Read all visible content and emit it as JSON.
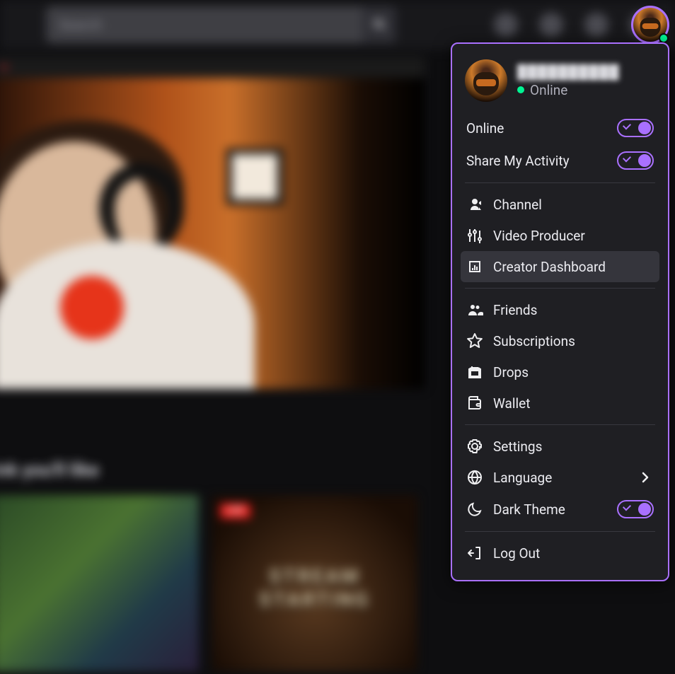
{
  "nav": {
    "search_placeholder": "Search"
  },
  "menu": {
    "username": "██████████",
    "status_text": "Online",
    "toggles": {
      "online": {
        "label": "Online",
        "on": true
      },
      "share_activity": {
        "label": "Share My Activity",
        "on": true
      },
      "dark_theme": {
        "label": "Dark Theme",
        "on": true
      }
    },
    "items": {
      "channel": "Channel",
      "video_producer": "Video Producer",
      "creator_dashboard": "Creator Dashboard",
      "friends": "Friends",
      "subscriptions": "Subscriptions",
      "drops": "Drops",
      "wallet": "Wallet",
      "settings": "Settings",
      "language": "Language",
      "logout": "Log Out"
    }
  },
  "background": {
    "section_heading": "ink you'll like",
    "live_badge": "LIVE",
    "thumb_b_text": "STREAM STARTING"
  }
}
